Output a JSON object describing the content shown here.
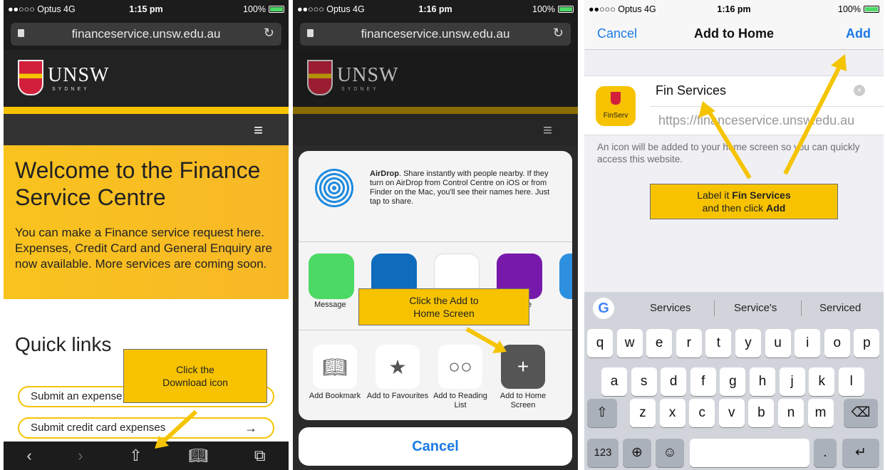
{
  "panel1": {
    "status": {
      "carrier": "●●○○○ Optus  4G",
      "time": "1:15 pm",
      "battery": "100%"
    },
    "url": "financeservice.unsw.edu.au",
    "brand": {
      "name": "UNSW",
      "sub": "SYDNEY"
    },
    "hero": {
      "title": "Welcome to the Finance Service Centre",
      "body": "You can make a Finance service request here. Expenses, Credit Card and General Enquiry are now available. More services are coming soon."
    },
    "quick_links": {
      "title": "Quick links",
      "items": [
        "Submit an expense",
        "Submit credit card expenses"
      ]
    },
    "callout": {
      "line1": "Click the",
      "line2": "Download icon"
    }
  },
  "panel2": {
    "status": {
      "carrier": "●●○○○ Optus  4G",
      "time": "1:16 pm",
      "battery": "100%"
    },
    "url": "financeservice.unsw.edu.au",
    "brand": {
      "name": "UNSW",
      "sub": "SYDNEY"
    },
    "airdrop": {
      "title": "AirDrop",
      "text": ". Share instantly with people nearby. If they turn on AirDrop from Control Centre on iOS or from Finder on the Mac, you'll see their names here. Just tap to share."
    },
    "apps": [
      {
        "label": "Message",
        "color": "#4cd964"
      },
      {
        "label": "",
        "color": "#0f6cbd"
      },
      {
        "label": "",
        "color": "#ffffff"
      },
      {
        "label": "te",
        "color": "#7719aa"
      }
    ],
    "actions": [
      {
        "label": "Add Bookmark",
        "icon": "book-icon"
      },
      {
        "label": "Add to Favourites",
        "icon": "star-icon"
      },
      {
        "label": "Add to Reading List",
        "icon": "glasses-icon"
      },
      {
        "label": "Add to Home Screen",
        "icon": "plus-icon"
      }
    ],
    "cancel": "Cancel",
    "callout": {
      "line1": "Click the Add to",
      "line2": "Home Screen"
    }
  },
  "panel3": {
    "status": {
      "carrier": "●●○○○ Optus  4G",
      "time": "1:16 pm",
      "battery": "100%"
    },
    "nav": {
      "cancel": "Cancel",
      "title": "Add to Home",
      "add": "Add"
    },
    "icon_label": "FinServ",
    "name_value": "Fin Services",
    "url_value": "https://financeservice.unsw.edu.au",
    "hint": "An icon will be added to your home screen so you can quickly access this website.",
    "callout": {
      "pre": "Label it ",
      "bold1": "Fin Services",
      "mid": "and then click ",
      "bold2": "Add"
    },
    "suggestions": [
      "Services",
      "Service's",
      "Serviced"
    ],
    "keys_row1": [
      "q",
      "w",
      "e",
      "r",
      "t",
      "y",
      "u",
      "i",
      "o",
      "p"
    ],
    "keys_row2": [
      "a",
      "s",
      "d",
      "f",
      "g",
      "h",
      "j",
      "k",
      "l"
    ],
    "keys_row3": [
      "z",
      "x",
      "c",
      "v",
      "b",
      "n",
      "m"
    ],
    "key_123": "123"
  }
}
